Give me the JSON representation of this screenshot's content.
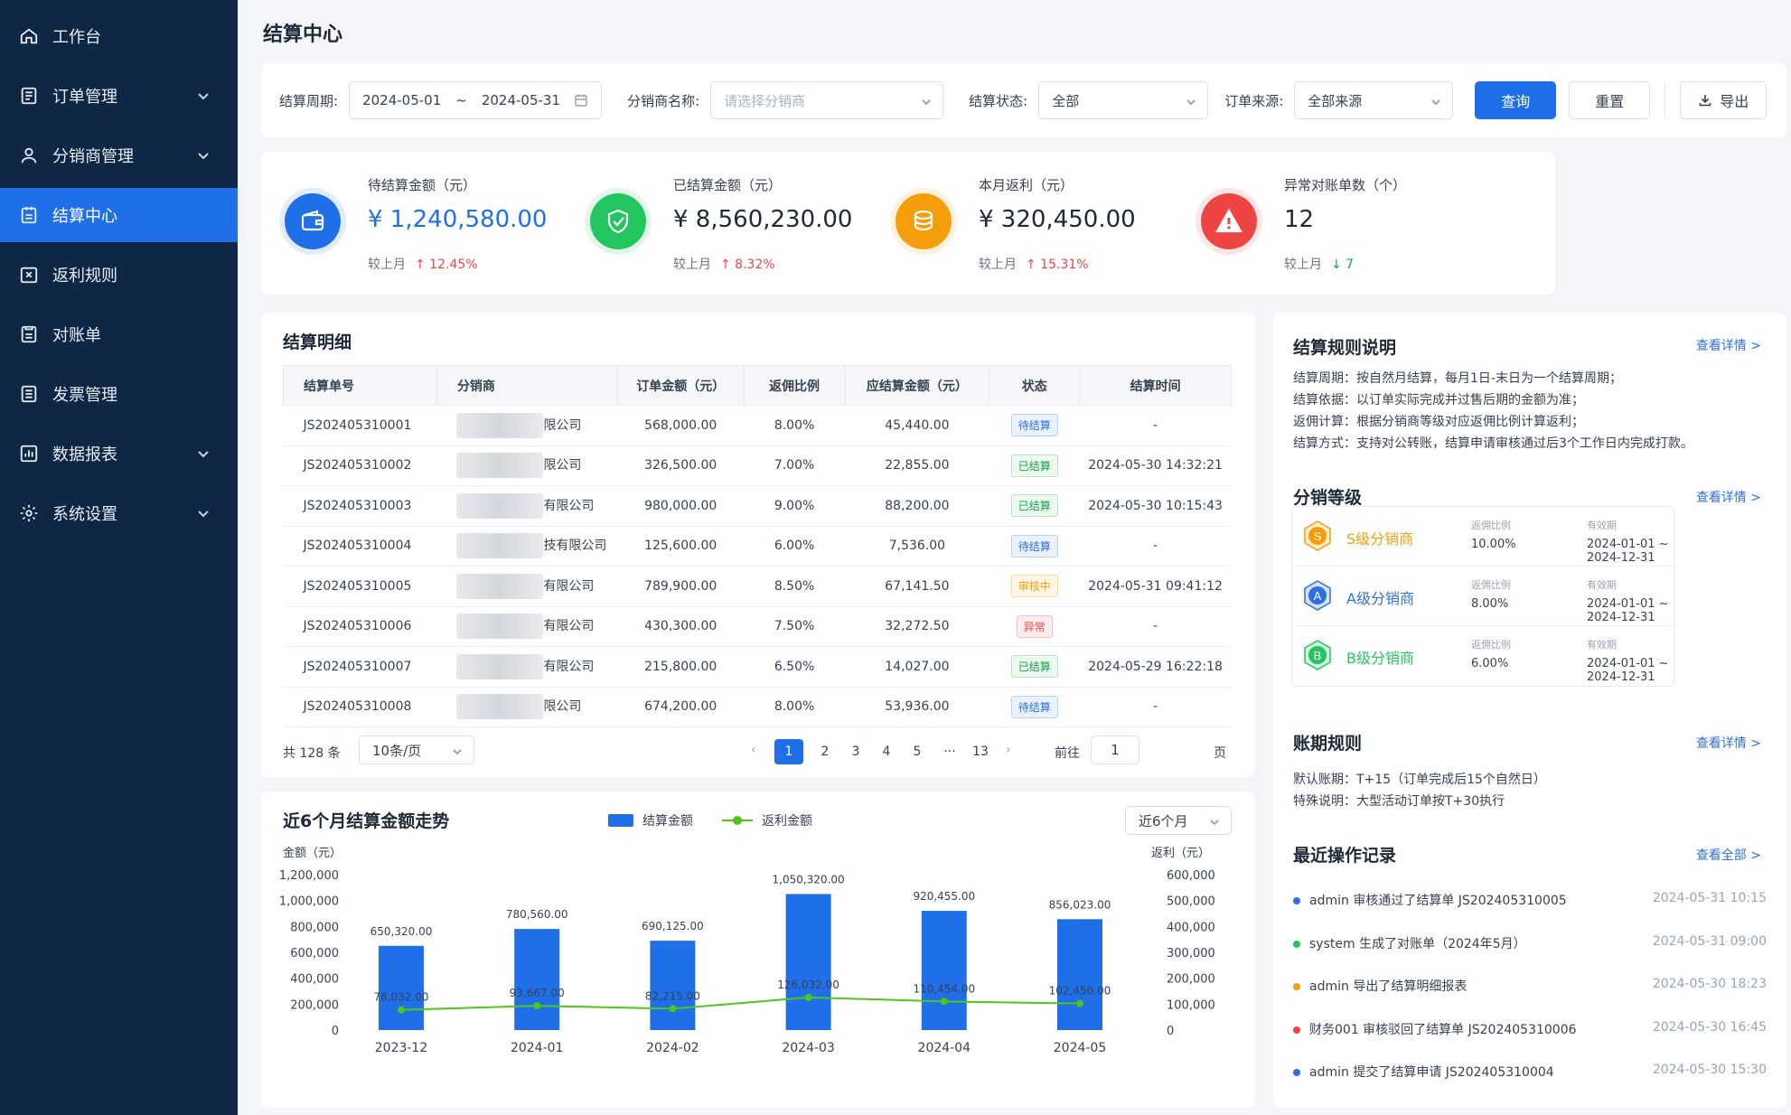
{
  "sidebar": {
    "items": [
      {
        "label": "工作台",
        "icon": "home-icon",
        "has_arrow": false
      },
      {
        "label": "订单管理",
        "icon": "order-icon",
        "has_arrow": true
      },
      {
        "label": "分销商管理",
        "icon": "user-icon",
        "has_arrow": true
      },
      {
        "label": "结算中心",
        "icon": "settlement-icon",
        "has_arrow": false,
        "active": true
      },
      {
        "label": "返利规则",
        "icon": "rebate-icon",
        "has_arrow": false
      },
      {
        "label": "对账单",
        "icon": "statement-icon",
        "has_arrow": false
      },
      {
        "label": "发票管理",
        "icon": "invoice-icon",
        "has_arrow": false
      },
      {
        "label": "数据报表",
        "icon": "report-icon",
        "has_arrow": true
      },
      {
        "label": "系统设置",
        "icon": "gear-icon",
        "has_arrow": true
      }
    ]
  },
  "page_title": "结算中心",
  "filters": {
    "period_label": "结算周期:",
    "period_start": "2024-05-01",
    "period_sep": "~",
    "period_end": "2024-05-31",
    "distributor_label": "分销商名称:",
    "distributor_placeholder": "请选择分销商",
    "status_label": "结算状态:",
    "status_value": "全部",
    "source_label": "订单来源:",
    "source_value": "全部来源",
    "query_label": "查询",
    "reset_label": "重置",
    "export_label": "导出"
  },
  "kpis": [
    {
      "label": "待结算金额（元）",
      "value": "¥ 1,240,580.00",
      "cmp_label": "较上月",
      "cmp_value": "↑ 12.45%",
      "color": "#1f6fe8",
      "icon": "wallet-icon"
    },
    {
      "label": "已结算金额（元）",
      "value": "¥ 8,560,230.00",
      "cmp_label": "较上月",
      "cmp_value": "↑ 8.32%",
      "color": "#22c55e",
      "icon": "check-shield-icon"
    },
    {
      "label": "本月返利（元）",
      "value": "¥ 320,450.00",
      "cmp_label": "较上月",
      "cmp_value": "↑ 15.31%",
      "color": "#f59e0b",
      "icon": "coins-icon"
    },
    {
      "label": "异常对账单数（个）",
      "value": "12",
      "cmp_label": "较上月",
      "cmp_value": "↓ 7",
      "color": "#ef4444",
      "icon": "warning-icon"
    }
  ],
  "detail": {
    "title": "结算明细",
    "columns": [
      "结算单号",
      "分销商",
      "订单金额（元）",
      "返佣比例",
      "应结算金额（元）",
      "状态",
      "结算时间"
    ],
    "rows": [
      {
        "no": "JS202405310001",
        "dist": "限公司",
        "amount": "568,000.00",
        "rate": "8.00%",
        "settle": "45,440.00",
        "status": "待结算",
        "status_type": "pending",
        "time": "-"
      },
      {
        "no": "JS202405310002",
        "dist": "限公司",
        "amount": "326,500.00",
        "rate": "7.00%",
        "settle": "22,855.00",
        "status": "已结算",
        "status_type": "done",
        "time": "2024-05-30 14:32:21"
      },
      {
        "no": "JS202405310003",
        "dist": "有限公司",
        "amount": "980,000.00",
        "rate": "9.00%",
        "settle": "88,200.00",
        "status": "已结算",
        "status_type": "done",
        "time": "2024-05-30 10:15:43"
      },
      {
        "no": "JS202405310004",
        "dist": "技有限公司",
        "amount": "125,600.00",
        "rate": "6.00%",
        "settle": "7,536.00",
        "status": "待结算",
        "status_type": "pending",
        "time": "-"
      },
      {
        "no": "JS202405310005",
        "dist": "有限公司",
        "amount": "789,900.00",
        "rate": "8.50%",
        "settle": "67,141.50",
        "status": "审核中",
        "status_type": "review",
        "time": "2024-05-31 09:41:12"
      },
      {
        "no": "JS202405310006",
        "dist": "有限公司",
        "amount": "430,300.00",
        "rate": "7.50%",
        "settle": "32,272.50",
        "status": "异常",
        "status_type": "error",
        "time": "-"
      },
      {
        "no": "JS202405310007",
        "dist": "有限公司",
        "amount": "215,800.00",
        "rate": "6.50%",
        "settle": "14,027.00",
        "status": "已结算",
        "status_type": "done",
        "time": "2024-05-29 16:22:18"
      },
      {
        "no": "JS202405310008",
        "dist": "限公司",
        "amount": "674,200.00",
        "rate": "8.00%",
        "settle": "53,936.00",
        "status": "待结算",
        "status_type": "pending",
        "time": "-"
      }
    ],
    "pager": {
      "total": "共 128 条",
      "page_size": "10条/页",
      "pages": [
        "1",
        "2",
        "3",
        "4",
        "5",
        "···",
        "13"
      ],
      "goto_label": "前往",
      "goto_value": "1",
      "goto_unit": "页"
    }
  },
  "chart_data": {
    "type": "bar",
    "title": "近6个月结算金额走势",
    "range_select": "近6个月",
    "categories": [
      "2023-12",
      "2024-01",
      "2024-02",
      "2024-03",
      "2024-04",
      "2024-05"
    ],
    "series": [
      {
        "name": "结算金额",
        "type": "bar",
        "axis": "left",
        "color": "#1f6fe8",
        "values": [
          650320,
          780560,
          690125,
          1050320,
          920455,
          856023
        ],
        "labels": [
          "650,320.00",
          "780,560.00",
          "690,125.00",
          "1,050,320.00",
          "920,455.00",
          "856,023.00"
        ]
      },
      {
        "name": "返利金额",
        "type": "line",
        "axis": "right",
        "color": "#52c41a",
        "values": [
          78032,
          93667,
          82215,
          126032,
          110454,
          102450
        ],
        "labels": [
          "78,032.00",
          "93,667.00",
          "82,215.00",
          "126,032.00",
          "110,454.00",
          "102,450.00"
        ]
      }
    ],
    "ylabel_left": "金额（元）",
    "ylabel_right": "返利（元）",
    "ylim_left": [
      0,
      1200000
    ],
    "ylim_right": [
      0,
      600000
    ],
    "yticks_left": [
      "0",
      "200,000",
      "400,000",
      "600,000",
      "800,000",
      "1,000,000",
      "1,200,000"
    ],
    "yticks_right": [
      "0",
      "100,000",
      "200,000",
      "300,000",
      "400,000",
      "500,000",
      "600,000"
    ],
    "legend": "top-center"
  },
  "rules": {
    "title": "结算规则说明",
    "link": "查看详情 >",
    "lines": [
      "结算周期：按自然月结算，每月1日-末日为一个结算周期；",
      "结算依据：以订单实际完成并过售后期的金额为准；",
      "返佣计算：根据分销商等级对应返佣比例计算返利；",
      "结算方式：支持对公转账，结算申请审核通过后3个工作日内完成打款。"
    ]
  },
  "levels": {
    "title": "分销等级",
    "link": "查看详情 >",
    "rate_label": "返佣比例",
    "valid_label": "有效期",
    "items": [
      {
        "badge": "S",
        "name": "S级分销商",
        "rate": "10.00%",
        "valid": "2024-01-01 ~ 2024-12-31",
        "color": "#f59e0b"
      },
      {
        "badge": "A",
        "name": "A级分销商",
        "rate": "8.00%",
        "valid": "2024-01-01 ~ 2024-12-31",
        "color": "#2f6fe0"
      },
      {
        "badge": "B",
        "name": "B级分销商",
        "rate": "6.00%",
        "valid": "2024-01-01 ~ 2024-12-31",
        "color": "#22c55e"
      }
    ]
  },
  "period_rules": {
    "title": "账期规则",
    "link": "查看详情 >",
    "lines": [
      "默认账期：T+15（订单完成后15个自然日）",
      "特殊说明：大型活动订单按T+30执行"
    ]
  },
  "logs": {
    "title": "最近操作记录",
    "link": "查看全部 >",
    "items": [
      {
        "text": "admin 审核通过了结算单 JS202405310005",
        "time": "2024-05-31  10:15",
        "color": "#2f6fe0"
      },
      {
        "text": "system 生成了对账单（2024年5月）",
        "time": "2024-05-31  09:00",
        "color": "#22c55e"
      },
      {
        "text": "admin 导出了结算明细报表",
        "time": "2024-05-30  18:23",
        "color": "#f59e0b"
      },
      {
        "text": "财务001 审核驳回了结算单 JS202405310006",
        "time": "2024-05-30  16:45",
        "color": "#ef4444"
      },
      {
        "text": "admin 提交了结算申请 JS202405310004",
        "time": "2024-05-30  15:30",
        "color": "#2f6fe0"
      }
    ]
  }
}
